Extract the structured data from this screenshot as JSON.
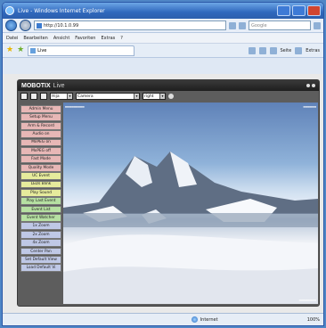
{
  "window": {
    "title": "Live - Windows Internet Explorer"
  },
  "addressbar": {
    "url": "http://10.1.0.99",
    "search_placeholder": "Google"
  },
  "menubar": {
    "items": [
      "Datei",
      "Bearbeiten",
      "Ansicht",
      "Favoriten",
      "Extras",
      "?"
    ]
  },
  "favbar": {
    "tab_label": "Live",
    "tools": [
      "Seite",
      "Extras"
    ]
  },
  "mobotix": {
    "brand": "MOBOTIX",
    "subtitle": "Live",
    "toolbar": {
      "select1": "Hija",
      "select2": "Camera",
      "select3": "right"
    },
    "menu_items": [
      {
        "label": "Admin Menu",
        "color": "#e7b7b6"
      },
      {
        "label": "Setup Menu",
        "color": "#e7b7b6"
      },
      {
        "label": "Arm & Record",
        "color": "#e7b7b6"
      },
      {
        "label": "Audio on",
        "color": "#e7b7b6"
      },
      {
        "label": "MxPEG on",
        "color": "#e7b7b6"
      },
      {
        "label": "MxPEG off",
        "color": "#e7b7b6"
      },
      {
        "label": "Fast Mode",
        "color": "#e7b7b6"
      },
      {
        "label": "Quality Mode",
        "color": "#e7b7b6"
      },
      {
        "label": "UC Event",
        "color": "#e6eb9c"
      },
      {
        "label": "LEDs Blink",
        "color": "#e6eb9c"
      },
      {
        "label": "Play Sound",
        "color": "#e6eb9c"
      },
      {
        "label": "Play Last Event",
        "color": "#b6e0a2"
      },
      {
        "label": "Event List",
        "color": "#b6e0a2"
      },
      {
        "label": "Event Watcher",
        "color": "#b6e0a2"
      },
      {
        "label": "1x Zoom",
        "color": "#bfc8e6"
      },
      {
        "label": "2x Zoom",
        "color": "#bfc8e6"
      },
      {
        "label": "4x Zoom",
        "color": "#bfc8e6"
      },
      {
        "label": "Center Pan",
        "color": "#bfc8e6"
      },
      {
        "label": "Set Default View",
        "color": "#bfc8e6"
      },
      {
        "label": "Load Default Vi",
        "color": "#bfc8e6"
      }
    ]
  },
  "statusbar": {
    "zone": "Internet",
    "zoom": "100%"
  }
}
